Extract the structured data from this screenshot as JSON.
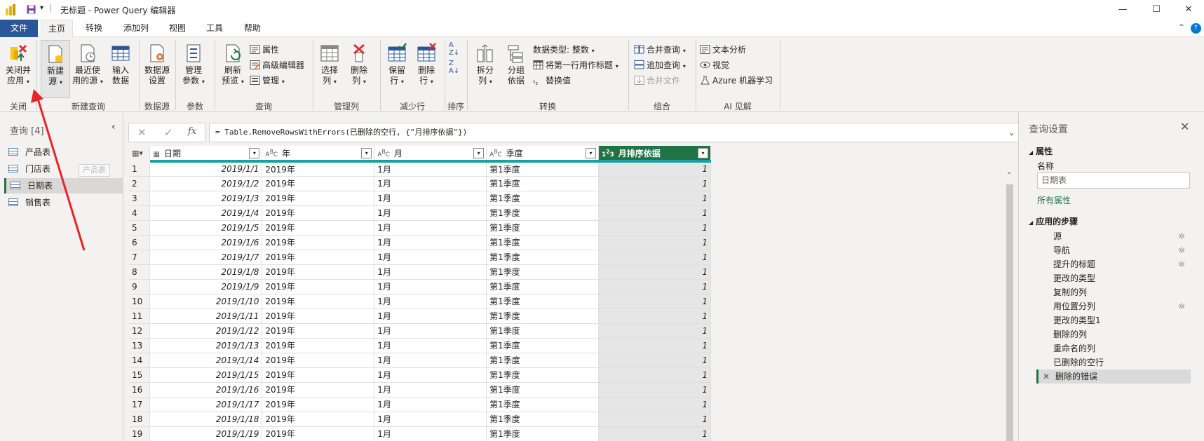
{
  "window": {
    "title": "无标题 - Power Query 编辑器",
    "controls": [
      "—",
      "☐",
      "✕"
    ]
  },
  "menu": {
    "file": "文件",
    "tabs": [
      "主页",
      "转换",
      "添加列",
      "视图",
      "工具",
      "帮助"
    ]
  },
  "ribbon": {
    "close_apply": [
      "关闭并",
      "应用"
    ],
    "new_source": [
      "新建",
      "源"
    ],
    "recent_sources": [
      "最近使",
      "用的源"
    ],
    "enter_data": [
      "输入",
      "数据"
    ],
    "data_source_settings": [
      "数据源",
      "设置"
    ],
    "manage_params": [
      "管理",
      "参数"
    ],
    "refresh_preview": [
      "刷新",
      "预览"
    ],
    "properties": "属性",
    "advanced_editor": "高级编辑器",
    "manage": "管理",
    "choose_columns": [
      "选择",
      "列"
    ],
    "remove_columns": [
      "删除",
      "列"
    ],
    "keep_rows": [
      "保留",
      "行"
    ],
    "remove_rows": [
      "删除",
      "行"
    ],
    "split_column": [
      "拆分",
      "列"
    ],
    "group_by": [
      "分组",
      "依据"
    ],
    "data_type": "数据类型: 整数",
    "first_row_header": "将第一行用作标题",
    "replace_values": "替换值",
    "merge_queries": "合并查询",
    "append_queries": "追加查询",
    "combine_files": "合并文件",
    "text_analytics": "文本分析",
    "vision": "视觉",
    "azure_ml": "Azure 机器学习",
    "groups": [
      "关闭",
      "新建查询",
      "数据源",
      "参数",
      "查询",
      "管理列",
      "减少行",
      "排序",
      "转换",
      "组合",
      "AI 见解"
    ]
  },
  "queries": {
    "header": "查询 [4]",
    "items": [
      "产品表",
      "门店表",
      "日期表",
      "销售表"
    ],
    "tooltip": "产品表",
    "selected_index": 2
  },
  "formula": {
    "cancel": "✕",
    "confirm": "✓",
    "fx": "fx",
    "text": "= Table.RemoveRowsWithErrors(已删除的空行, {\"月排序依据\"})"
  },
  "grid": {
    "columns": [
      {
        "type": "日历",
        "name": "日期"
      },
      {
        "type": "ABC",
        "name": "年"
      },
      {
        "type": "ABC",
        "name": "月"
      },
      {
        "type": "ABC",
        "name": "季度"
      },
      {
        "type": "123",
        "name": "月排序依据"
      }
    ],
    "rows": [
      [
        "1",
        "2019/1/1",
        "2019年",
        "1月",
        "第1季度",
        "1"
      ],
      [
        "2",
        "2019/1/2",
        "2019年",
        "1月",
        "第1季度",
        "1"
      ],
      [
        "3",
        "2019/1/3",
        "2019年",
        "1月",
        "第1季度",
        "1"
      ],
      [
        "4",
        "2019/1/4",
        "2019年",
        "1月",
        "第1季度",
        "1"
      ],
      [
        "5",
        "2019/1/5",
        "2019年",
        "1月",
        "第1季度",
        "1"
      ],
      [
        "6",
        "2019/1/6",
        "2019年",
        "1月",
        "第1季度",
        "1"
      ],
      [
        "7",
        "2019/1/7",
        "2019年",
        "1月",
        "第1季度",
        "1"
      ],
      [
        "8",
        "2019/1/8",
        "2019年",
        "1月",
        "第1季度",
        "1"
      ],
      [
        "9",
        "2019/1/9",
        "2019年",
        "1月",
        "第1季度",
        "1"
      ],
      [
        "10",
        "2019/1/10",
        "2019年",
        "1月",
        "第1季度",
        "1"
      ],
      [
        "11",
        "2019/1/11",
        "2019年",
        "1月",
        "第1季度",
        "1"
      ],
      [
        "12",
        "2019/1/12",
        "2019年",
        "1月",
        "第1季度",
        "1"
      ],
      [
        "13",
        "2019/1/13",
        "2019年",
        "1月",
        "第1季度",
        "1"
      ],
      [
        "14",
        "2019/1/14",
        "2019年",
        "1月",
        "第1季度",
        "1"
      ],
      [
        "15",
        "2019/1/15",
        "2019年",
        "1月",
        "第1季度",
        "1"
      ],
      [
        "16",
        "2019/1/16",
        "2019年",
        "1月",
        "第1季度",
        "1"
      ],
      [
        "17",
        "2019/1/17",
        "2019年",
        "1月",
        "第1季度",
        "1"
      ],
      [
        "18",
        "2019/1/18",
        "2019年",
        "1月",
        "第1季度",
        "1"
      ],
      [
        "19",
        "2019/1/19",
        "2019年",
        "1月",
        "第1季度",
        "1"
      ]
    ]
  },
  "settings": {
    "title": "查询设置",
    "properties_header": "属性",
    "name_label": "名称",
    "name_value": "日期表",
    "all_properties": "所有属性",
    "steps_header": "应用的步骤",
    "steps": [
      {
        "name": "源",
        "gear": true
      },
      {
        "name": "导航",
        "gear": true
      },
      {
        "name": "提升的标题",
        "gear": true
      },
      {
        "name": "更改的类型",
        "gear": false
      },
      {
        "name": "复制的列",
        "gear": false
      },
      {
        "name": "用位置分列",
        "gear": true
      },
      {
        "name": "更改的类型1",
        "gear": false
      },
      {
        "name": "删除的列",
        "gear": false
      },
      {
        "name": "重命名的列",
        "gear": false
      },
      {
        "name": "已删除的空行",
        "gear": false
      },
      {
        "name": "删除的错误",
        "gear": false
      }
    ],
    "selected_step": 10
  },
  "colors": {
    "accent_green": "#217346",
    "file_blue": "#2b579a",
    "header_teal": "#19a1a1",
    "annotation_red": "#e8232a"
  }
}
